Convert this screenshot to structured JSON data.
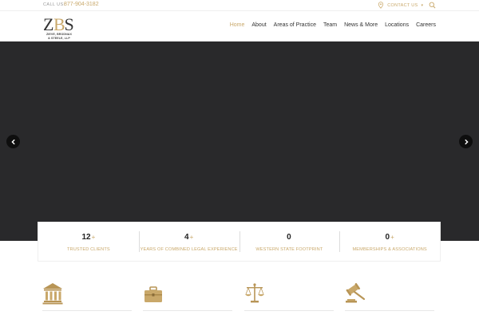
{
  "topbar": {
    "call_label": "CALL US:",
    "phone": "877-904-3182",
    "contact_label": "CONTACT US",
    "contact_caret": "▾"
  },
  "logo": {
    "letters": "ZBS",
    "line1": "ZIEVE, BRODNAX",
    "line2": "& STEELE, LLP"
  },
  "nav": {
    "items": [
      "Home",
      "About",
      "Areas of Practice",
      "Team",
      "News & More",
      "Locations",
      "Careers"
    ],
    "active": "Home"
  },
  "colors": {
    "accent": "#c9a86a",
    "hero_bg": "#29292b",
    "arrow_bg": "#0e0e0e"
  },
  "stats": [
    {
      "number": "12",
      "plus": "+",
      "label": "TRUSTED CLIENTS"
    },
    {
      "number": "4",
      "plus": "+",
      "label": "YEARS OF COMBINED LEGAL EXPERIENCE"
    },
    {
      "number": "0",
      "plus": "",
      "label": "WESTERN STATE FOOTPRINT"
    },
    {
      "number": "0",
      "plus": "+",
      "label": "MEMBERSHIPS & ASSOCIATIONS"
    }
  ],
  "practice_icons": [
    "courthouse-icon",
    "briefcase-icon",
    "scales-icon",
    "gavel-icon"
  ]
}
